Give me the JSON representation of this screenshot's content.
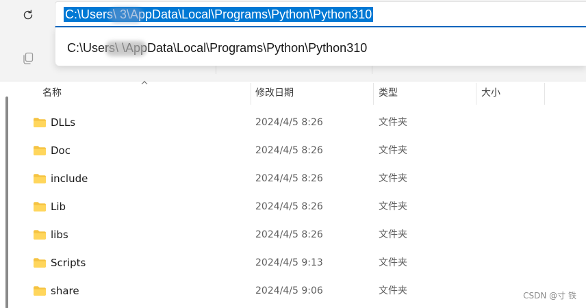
{
  "address_bar": {
    "selected_path": "C:\\Users\\      3\\AppData\\Local\\Programs\\Python\\Python310"
  },
  "suggestion": {
    "path": "C:\\Users\\         \\AppData\\Local\\Programs\\Python\\Python310"
  },
  "columns": {
    "name": "名称",
    "modified": "修改日期",
    "type": "类型",
    "size": "大小"
  },
  "rows": [
    {
      "name": "DLLs",
      "modified": "2024/4/5 8:26",
      "type": "文件夹"
    },
    {
      "name": "Doc",
      "modified": "2024/4/5 8:26",
      "type": "文件夹"
    },
    {
      "name": "include",
      "modified": "2024/4/5 8:26",
      "type": "文件夹"
    },
    {
      "name": "Lib",
      "modified": "2024/4/5 8:26",
      "type": "文件夹"
    },
    {
      "name": "libs",
      "modified": "2024/4/5 8:26",
      "type": "文件夹"
    },
    {
      "name": "Scripts",
      "modified": "2024/4/5 9:13",
      "type": "文件夹"
    },
    {
      "name": "share",
      "modified": "2024/4/5 9:06",
      "type": "文件夹"
    }
  ],
  "watermark": "CSDN @寸 铁",
  "icons": {
    "refresh": "refresh-icon",
    "copy": "copy-icon",
    "folder": "folder-icon",
    "sort": "sort-up-icon"
  },
  "colors": {
    "selection": "#0078d4",
    "focus_underline": "#0067c0",
    "folder": "#f5c342"
  }
}
